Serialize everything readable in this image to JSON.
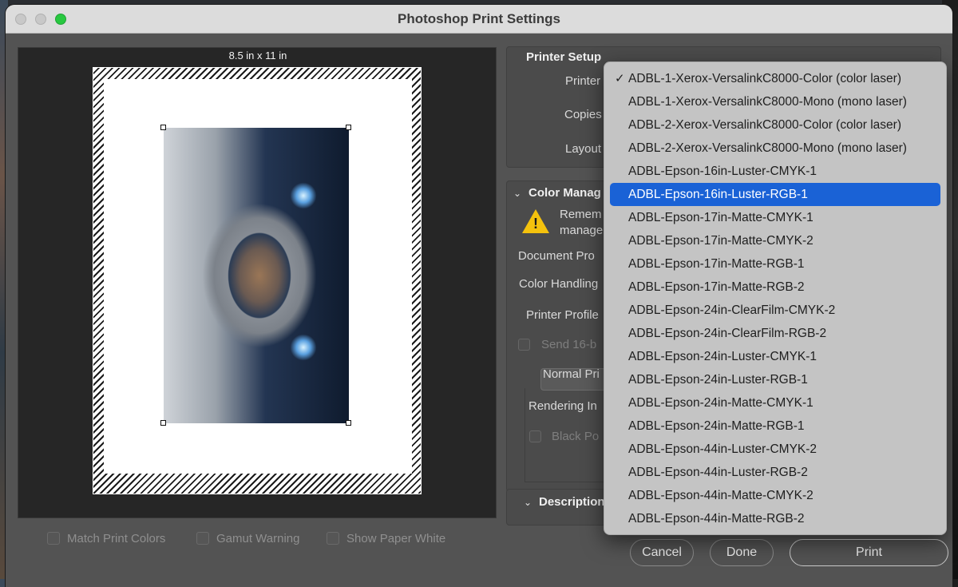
{
  "window": {
    "title": "Photoshop Print Settings"
  },
  "preview": {
    "paper_size": "8.5 in x 11 in",
    "checkboxes": [
      {
        "label": "Match Print Colors",
        "checked": false
      },
      {
        "label": "Gamut Warning",
        "checked": false
      },
      {
        "label": "Show Paper White",
        "checked": false
      }
    ]
  },
  "printer_setup": {
    "heading": "Printer Setup",
    "printer_label": "Printer",
    "copies_label": "Copies",
    "layout_label": "Layout"
  },
  "color_management": {
    "heading": "Color Manag",
    "warning_line1": "Remem",
    "warning_line2": "manage",
    "document_profile_label": "Document Pro",
    "color_handling_label": "Color Handling",
    "printer_profile_label": "Printer Profile",
    "send16_label": "Send 16-b",
    "print_mode_value": "Normal Pri",
    "rendering_intent_label": "Rendering In",
    "black_point_label": "Black Po"
  },
  "description": {
    "heading": "Description"
  },
  "buttons": {
    "cancel": "Cancel",
    "done": "Done",
    "print": "Print"
  },
  "printer_menu": {
    "checkmark": "✓",
    "highlighted_index": 5,
    "items": [
      {
        "label": "ADBL-1-Xerox-VersalinkC8000-Color (color laser)",
        "checked": true
      },
      {
        "label": "ADBL-1-Xerox-VersalinkC8000-Mono (mono laser)",
        "checked": false
      },
      {
        "label": "ADBL-2-Xerox-VersalinkC8000-Color (color laser)",
        "checked": false
      },
      {
        "label": "ADBL-2-Xerox-VersalinkC8000-Mono (mono laser)",
        "checked": false
      },
      {
        "label": "ADBL-Epson-16in-Luster-CMYK-1",
        "checked": false
      },
      {
        "label": "ADBL-Epson-16in-Luster-RGB-1",
        "checked": false
      },
      {
        "label": "ADBL-Epson-17in-Matte-CMYK-1",
        "checked": false
      },
      {
        "label": "ADBL-Epson-17in-Matte-CMYK-2",
        "checked": false
      },
      {
        "label": "ADBL-Epson-17in-Matte-RGB-1",
        "checked": false
      },
      {
        "label": "ADBL-Epson-17in-Matte-RGB-2",
        "checked": false
      },
      {
        "label": "ADBL-Epson-24in-ClearFilm-CMYK-2",
        "checked": false
      },
      {
        "label": "ADBL-Epson-24in-ClearFilm-RGB-2",
        "checked": false
      },
      {
        "label": "ADBL-Epson-24in-Luster-CMYK-1",
        "checked": false
      },
      {
        "label": "ADBL-Epson-24in-Luster-RGB-1",
        "checked": false
      },
      {
        "label": "ADBL-Epson-24in-Matte-CMYK-1",
        "checked": false
      },
      {
        "label": "ADBL-Epson-24in-Matte-RGB-1",
        "checked": false
      },
      {
        "label": "ADBL-Epson-44in-Luster-CMYK-2",
        "checked": false
      },
      {
        "label": "ADBL-Epson-44in-Luster-RGB-2",
        "checked": false
      },
      {
        "label": "ADBL-Epson-44in-Matte-CMYK-2",
        "checked": false
      },
      {
        "label": "ADBL-Epson-44in-Matte-RGB-2",
        "checked": false
      }
    ]
  },
  "colors": {
    "menu_highlight": "#1a62d6",
    "window_bg": "#535353",
    "warning_icon": "#f4c20d",
    "maximize_button": "#28c840"
  }
}
